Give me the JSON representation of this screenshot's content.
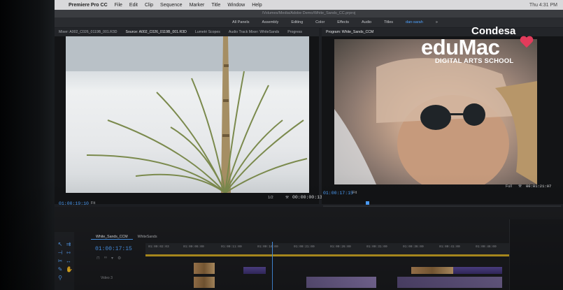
{
  "menubar": {
    "apple": "",
    "app": "Premiere Pro CC",
    "items": [
      "File",
      "Edit",
      "Clip",
      "Sequence",
      "Marker",
      "Title",
      "Window",
      "Help"
    ],
    "clock": "Thu 4:31 PM"
  },
  "pathbar": "/Volumes/Media/Adobe Demo/White_Sands_CC.prproj",
  "workspaces": [
    "All Panels",
    "Assembly",
    "Editing",
    "Color",
    "Effects",
    "Audio",
    "Titles",
    "dan-sarah"
  ],
  "workspace_active": "dan-sarah",
  "source_tabs": {
    "mixer": "Mixer: A002_C026_0119B_001.R3D",
    "source": "Source: A002_C026_0119B_001.R3D",
    "lumetri": "Lumetri Scopes",
    "audio_track": "Audio Track Mixer: WhiteSands",
    "progress": "Progress"
  },
  "program_tab": "Program: White_Sands_CCM",
  "source_monitor": {
    "timecode_in": "01:00:19:10",
    "fit": "Fit",
    "resolution": "1/2",
    "timecode_dur": "00:00:00:13",
    "playhead_fraction": 0.44
  },
  "program_monitor": {
    "timecode": "01:00:17:15",
    "fit": "Fit",
    "resolution": "Full",
    "timecode_dur": "00:01:21:07",
    "playhead_fraction": 0.18
  },
  "controls": [
    "marker",
    "in",
    "out",
    "go-in",
    "step-back",
    "play",
    "step-fwd",
    "go-out",
    "insert",
    "overwrite",
    "export-frame"
  ],
  "timeline": {
    "tabs": [
      "White_Sands_CCM",
      "WhiteSands"
    ],
    "active_tab": "White_Sands_CCM",
    "timecode": "01:00:17:15",
    "ruler": [
      "01:00:02:03",
      "01:00:06:00",
      "01:00:11:00",
      "01:00:16:00",
      "01:00:21:00",
      "01:00:26:00",
      "01:00:31:00",
      "01:00:36:00",
      "01:00:41:00",
      "01:00:46:00"
    ],
    "track_label": "Video 3"
  },
  "logo": {
    "line1": "Condesa",
    "line2": "eduMac",
    "line3": "DIGITAL ARTS SCHOOL",
    "heart_color": "#e23b5b"
  },
  "colors": {
    "accent": "#4ea2ff",
    "work_area": "#c9a322",
    "clip_purple": "#5b4b9c"
  }
}
